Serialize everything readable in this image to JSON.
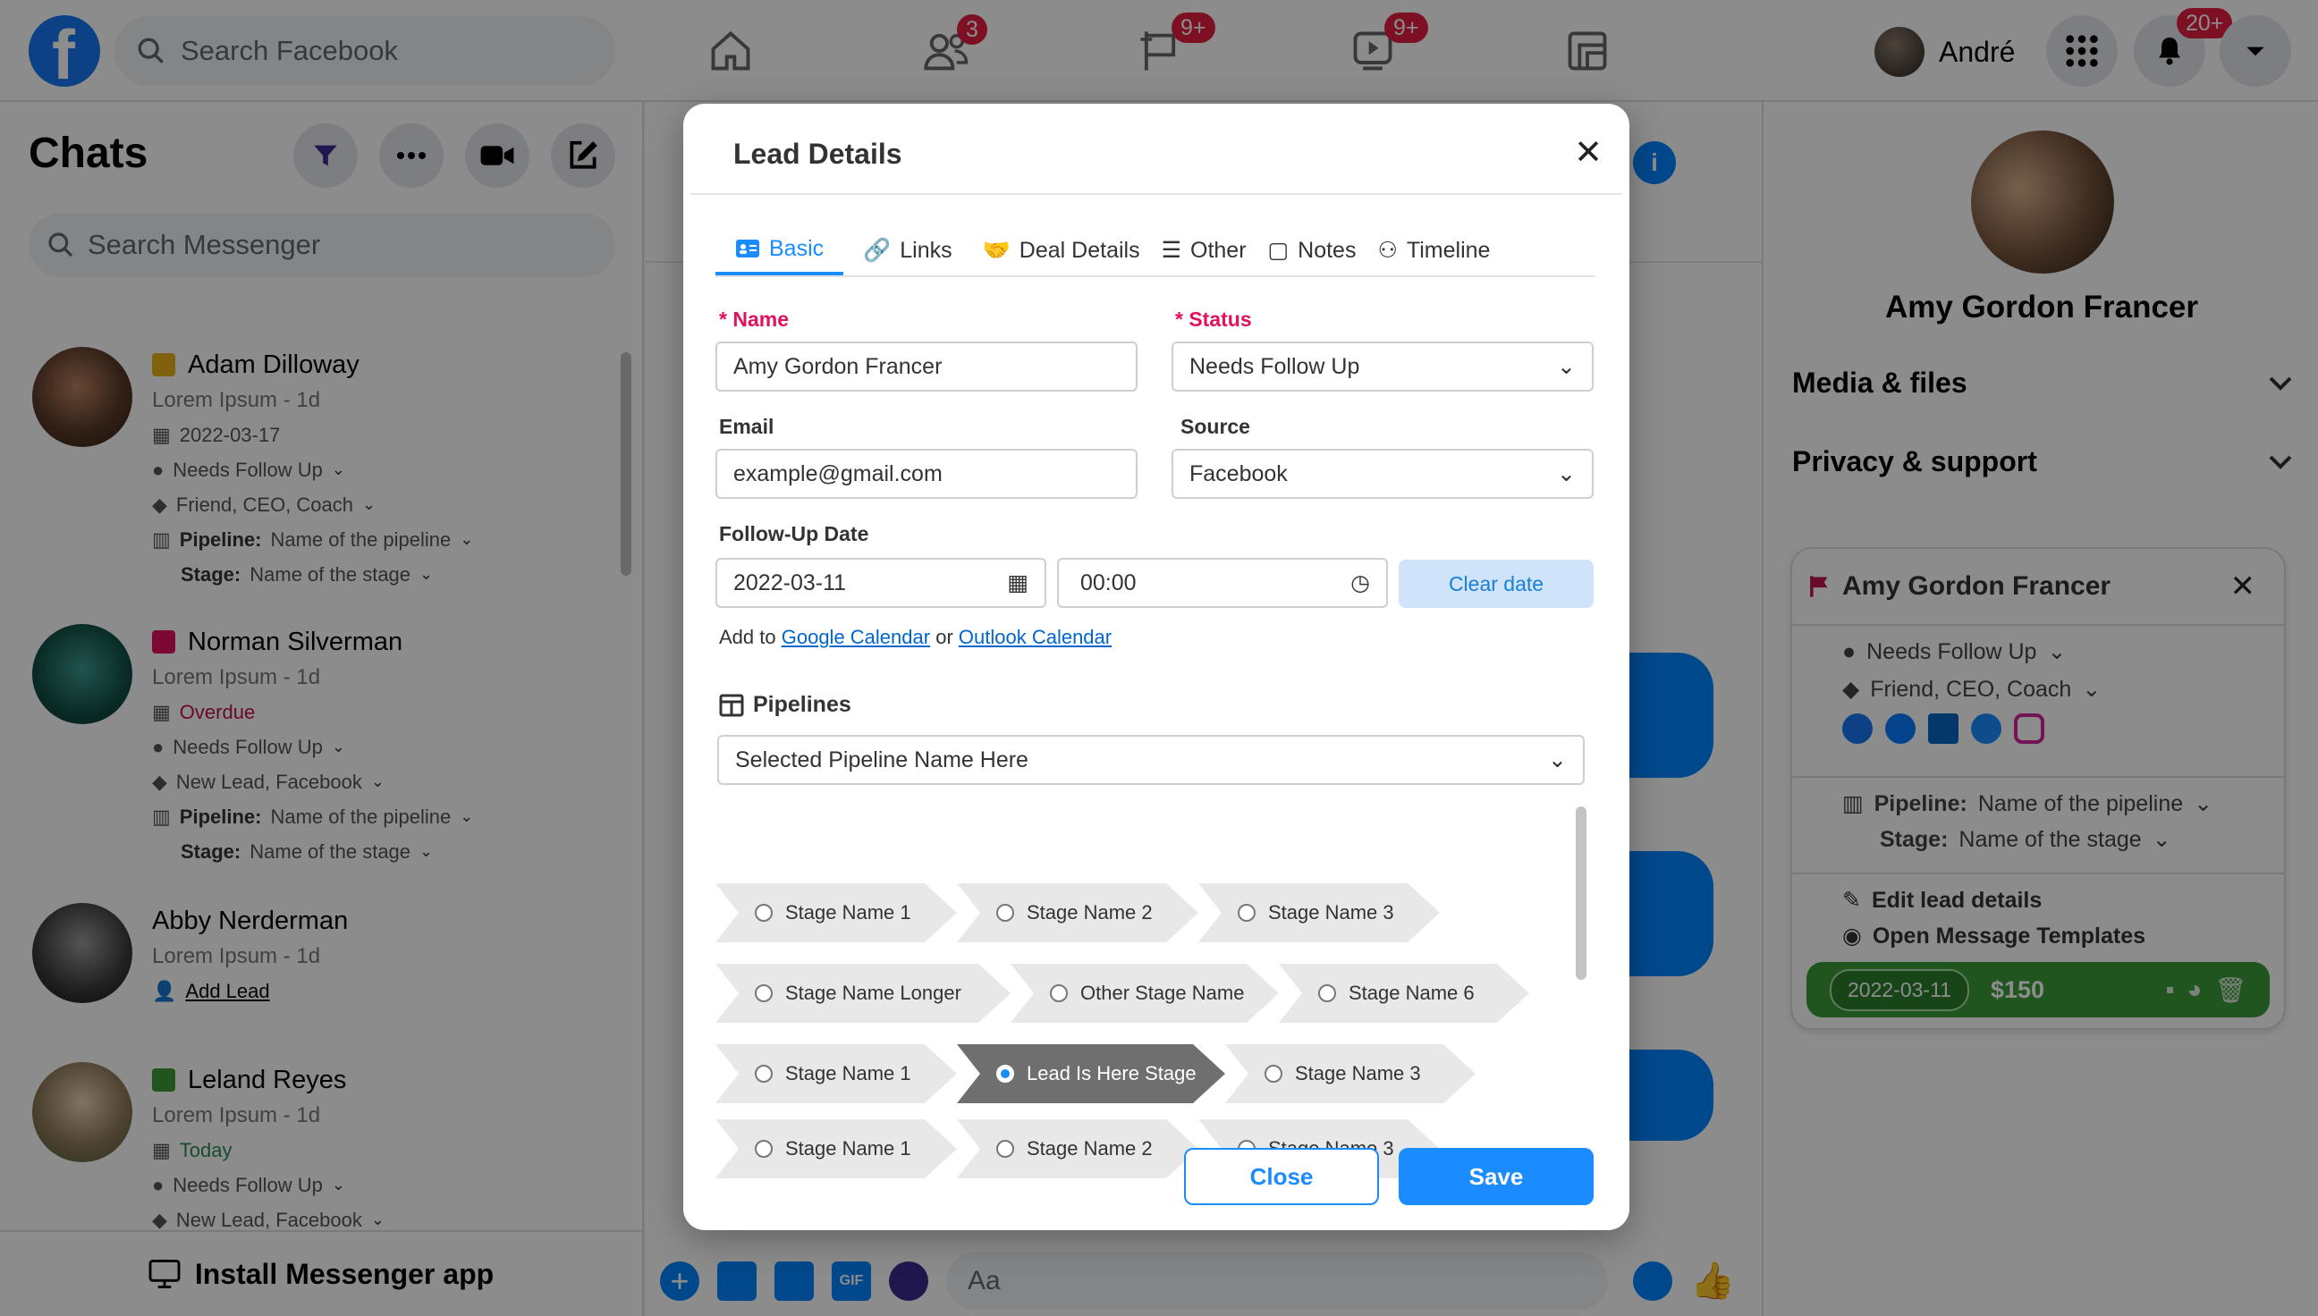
{
  "topbar": {
    "search_placeholder": "Search Facebook",
    "friends_badge": "3",
    "pages_badge": "9+",
    "watch_badge": "9+",
    "account_name": "André",
    "notifications_badge": "20+"
  },
  "chats": {
    "title": "Chats",
    "search_placeholder": "Search Messenger",
    "install_label": "Install Messenger app",
    "contacts": [
      {
        "name": "Adam Dilloway",
        "preview": "Lorem Ipsum - 1d",
        "date": "2022-03-17",
        "status": "Needs Follow Up",
        "tags": "Friend, CEO, Coach",
        "pipeline_label": "Pipeline:",
        "pipeline": "Name of the pipeline",
        "stage_label": "Stage:",
        "stage": "Name of the stage",
        "color": "#e8b11a"
      },
      {
        "name": "Norman Silverman",
        "preview": "Lorem Ipsum - 1d",
        "date": "Overdue",
        "status": "Needs Follow Up",
        "tags": "New Lead, Facebook",
        "pipeline_label": "Pipeline:",
        "pipeline": "Name of the pipeline",
        "stage_label": "Stage:",
        "stage": "Name of the stage",
        "color": "#e0115f"
      },
      {
        "name": "Abby Nerderman",
        "preview": "Lorem Ipsum - 1d",
        "add_lead": "Add Lead"
      },
      {
        "name": "Leland Reyes",
        "preview": "Lorem Ipsum - 1d",
        "date": "Today",
        "status": "Needs Follow Up",
        "tags": "New Lead, Facebook",
        "color": "#3b9b3b"
      }
    ]
  },
  "composer": {
    "placeholder": "Aa"
  },
  "right_panel": {
    "name": "Amy Gordon Francer",
    "media_files": "Media & files",
    "privacy_support": "Privacy & support",
    "lead_card": {
      "name": "Amy Gordon Francer",
      "status": "Needs Follow Up",
      "tags": "Friend, CEO, Coach",
      "pipeline_label": "Pipeline:",
      "pipeline": "Name of the pipeline",
      "stage_label": "Stage:",
      "stage": "Name of the stage",
      "edit_label": "Edit lead details",
      "templates_label": "Open Message Templates",
      "date": "2022-03-11",
      "value": "$150"
    }
  },
  "modal": {
    "title": "Lead Details",
    "tabs": [
      {
        "label": "Basic"
      },
      {
        "label": "Links"
      },
      {
        "label": "Deal Details"
      },
      {
        "label": "Other"
      },
      {
        "label": "Notes"
      },
      {
        "label": "Timeline"
      }
    ],
    "name_label": "Name",
    "name_value": "Amy Gordon Francer",
    "status_label": "Status",
    "status_value": "Needs Follow Up",
    "email_label": "Email",
    "email_value": "example@gmail.com",
    "source_label": "Source",
    "source_value": "Facebook",
    "followup_label": "Follow-Up Date",
    "date_value": "2022-03-11",
    "time_value": "00:00",
    "clear_date": "Clear date",
    "add_to": "Add to",
    "google_calendar": "Google Calendar",
    "or": "or",
    "outlook_calendar": "Outlook Calendar",
    "pipelines_label": "Pipelines",
    "pipeline_select": "Selected Pipeline Name Here",
    "stage_rows": [
      [
        "Stage Name 1",
        "Stage Name 2",
        "Stage Name 3"
      ],
      [
        "Stage Name Longer",
        "Other Stage Name",
        "Stage Name 6"
      ],
      [
        "Stage Name 1",
        "Lead Is Here Stage",
        "Stage Name 3"
      ],
      [
        "Stage Name 1",
        "Stage Name 2",
        "Stage Name 3"
      ]
    ],
    "selected_stage": "Lead Is Here Stage",
    "close_label": "Close",
    "save_label": "Save"
  },
  "colors": {
    "accent": "#1a8cff",
    "facebook_blue": "#1877f2",
    "required": "#e0115f",
    "green": "#3b9b3b"
  }
}
